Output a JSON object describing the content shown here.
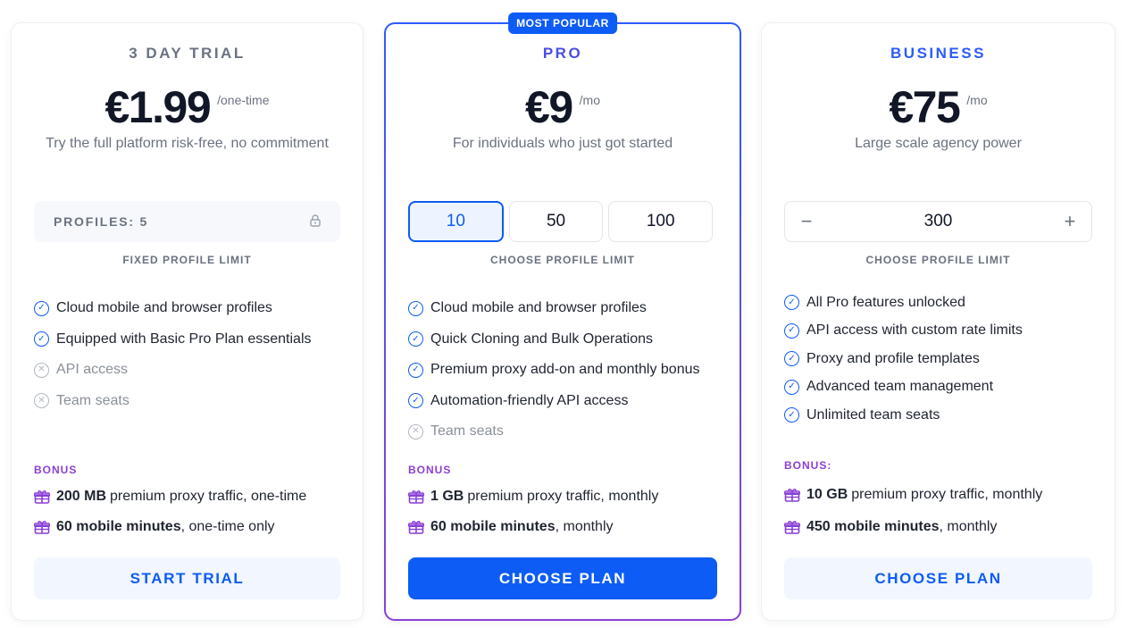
{
  "colors": {
    "accent": "#0d5cf5",
    "bonus": "#8b3fd6",
    "muted": "#6b7280",
    "popular_gradient_end": "#8b3fd6"
  },
  "trial": {
    "name": "3 DAY TRIAL",
    "price": "€1.99",
    "period": "/one-time",
    "description": "Try the full platform risk-free, no commitment",
    "profiles_label": "PROFILES: 5",
    "limit_caption": "FIXED PROFILE LIMIT",
    "features": [
      {
        "text": "Cloud mobile and browser profiles",
        "included": true
      },
      {
        "text": "Equipped with Basic Pro Plan essentials",
        "included": true
      },
      {
        "text": "API access",
        "included": false
      },
      {
        "text": "Team seats",
        "included": false
      }
    ],
    "bonus_title": "BONUS",
    "bonuses": [
      {
        "bold": "200 MB",
        "rest": "premium proxy traffic, one-time"
      },
      {
        "bold": "60 mobile minutes",
        "rest": ", one-time only"
      }
    ],
    "cta": "START TRIAL"
  },
  "pro": {
    "badge": "MOST POPULAR",
    "name": "PRO",
    "price": "€9",
    "period": "/mo",
    "description": "For individuals who just got started",
    "options": [
      "10",
      "50",
      "100"
    ],
    "selected_option": "10",
    "limit_caption": "CHOOSE PROFILE LIMIT",
    "features": [
      {
        "text": "Cloud mobile and browser profiles",
        "included": true
      },
      {
        "text": "Quick Cloning and Bulk Operations",
        "included": true
      },
      {
        "text": "Premium proxy add-on and monthly bonus",
        "included": true
      },
      {
        "text": "Automation-friendly API access",
        "included": true
      },
      {
        "text": "Team seats",
        "included": false
      }
    ],
    "bonus_title": "BONUS",
    "bonuses": [
      {
        "bold": "1 GB",
        "rest": "premium proxy traffic, monthly"
      },
      {
        "bold": "60 mobile minutes",
        "rest": ", monthly"
      }
    ],
    "cta": "CHOOSE PLAN"
  },
  "business": {
    "name": "BUSINESS",
    "price": "€75",
    "period": "/mo",
    "description": "Large scale agency power",
    "stepper_value": "300",
    "limit_caption": "CHOOSE PROFILE LIMIT",
    "features": [
      {
        "text": "All Pro features unlocked",
        "included": true
      },
      {
        "text": "API access with custom rate limits",
        "included": true
      },
      {
        "text": "Proxy and profile templates",
        "included": true
      },
      {
        "text": "Advanced team management",
        "included": true
      },
      {
        "text": "Unlimited team seats",
        "included": true
      }
    ],
    "bonus_title": "BONUS:",
    "bonuses": [
      {
        "bold": "10 GB",
        "rest": "premium proxy traffic, monthly"
      },
      {
        "bold": "450 mobile minutes",
        "rest": ", monthly"
      }
    ],
    "cta": "CHOOSE PLAN"
  }
}
